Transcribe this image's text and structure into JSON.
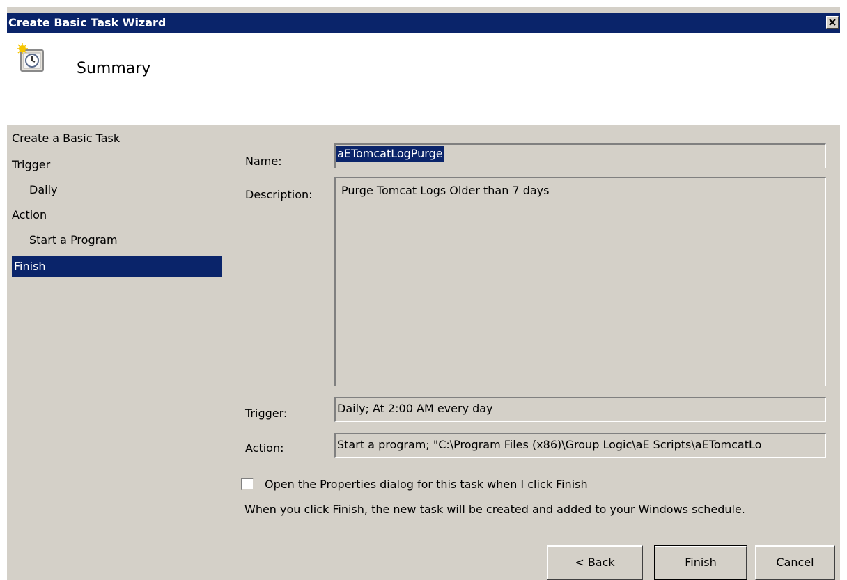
{
  "window": {
    "title": "Create Basic Task Wizard"
  },
  "header": {
    "title": "Summary",
    "icon": "task-scheduler-clock-icon"
  },
  "nav": {
    "items": [
      {
        "label": "Create a Basic Task",
        "selected": false
      },
      {
        "label": "Trigger",
        "selected": false
      },
      {
        "label": "Daily",
        "selected": false
      },
      {
        "label": "Action",
        "selected": false
      },
      {
        "label": "Start a Program",
        "selected": false
      },
      {
        "label": "Finish",
        "selected": true
      }
    ]
  },
  "summary": {
    "name_label": "Name:",
    "name_value": "aETomcatLogPurge",
    "description_label": "Description:",
    "description_value": "Purge Tomcat Logs Older than 7 days",
    "trigger_label": "Trigger:",
    "trigger_value": "Daily; At 2:00 AM every day",
    "action_label": "Action:",
    "action_value": "Start a program; \"C:\\Program Files (x86)\\Group Logic\\aE Scripts\\aETomcatLo"
  },
  "options": {
    "open_properties_label": "Open the Properties dialog for this task when I click Finish",
    "open_properties_checked": false,
    "info_text": "When you click Finish, the new task will be created and added to your Windows schedule."
  },
  "buttons": {
    "back_label": "< Back",
    "finish_label": "Finish",
    "cancel_label": "Cancel"
  },
  "colors": {
    "title_bar": "#0a246a",
    "dialog_face": "#d4d0c8",
    "selection": "#0a246a"
  }
}
